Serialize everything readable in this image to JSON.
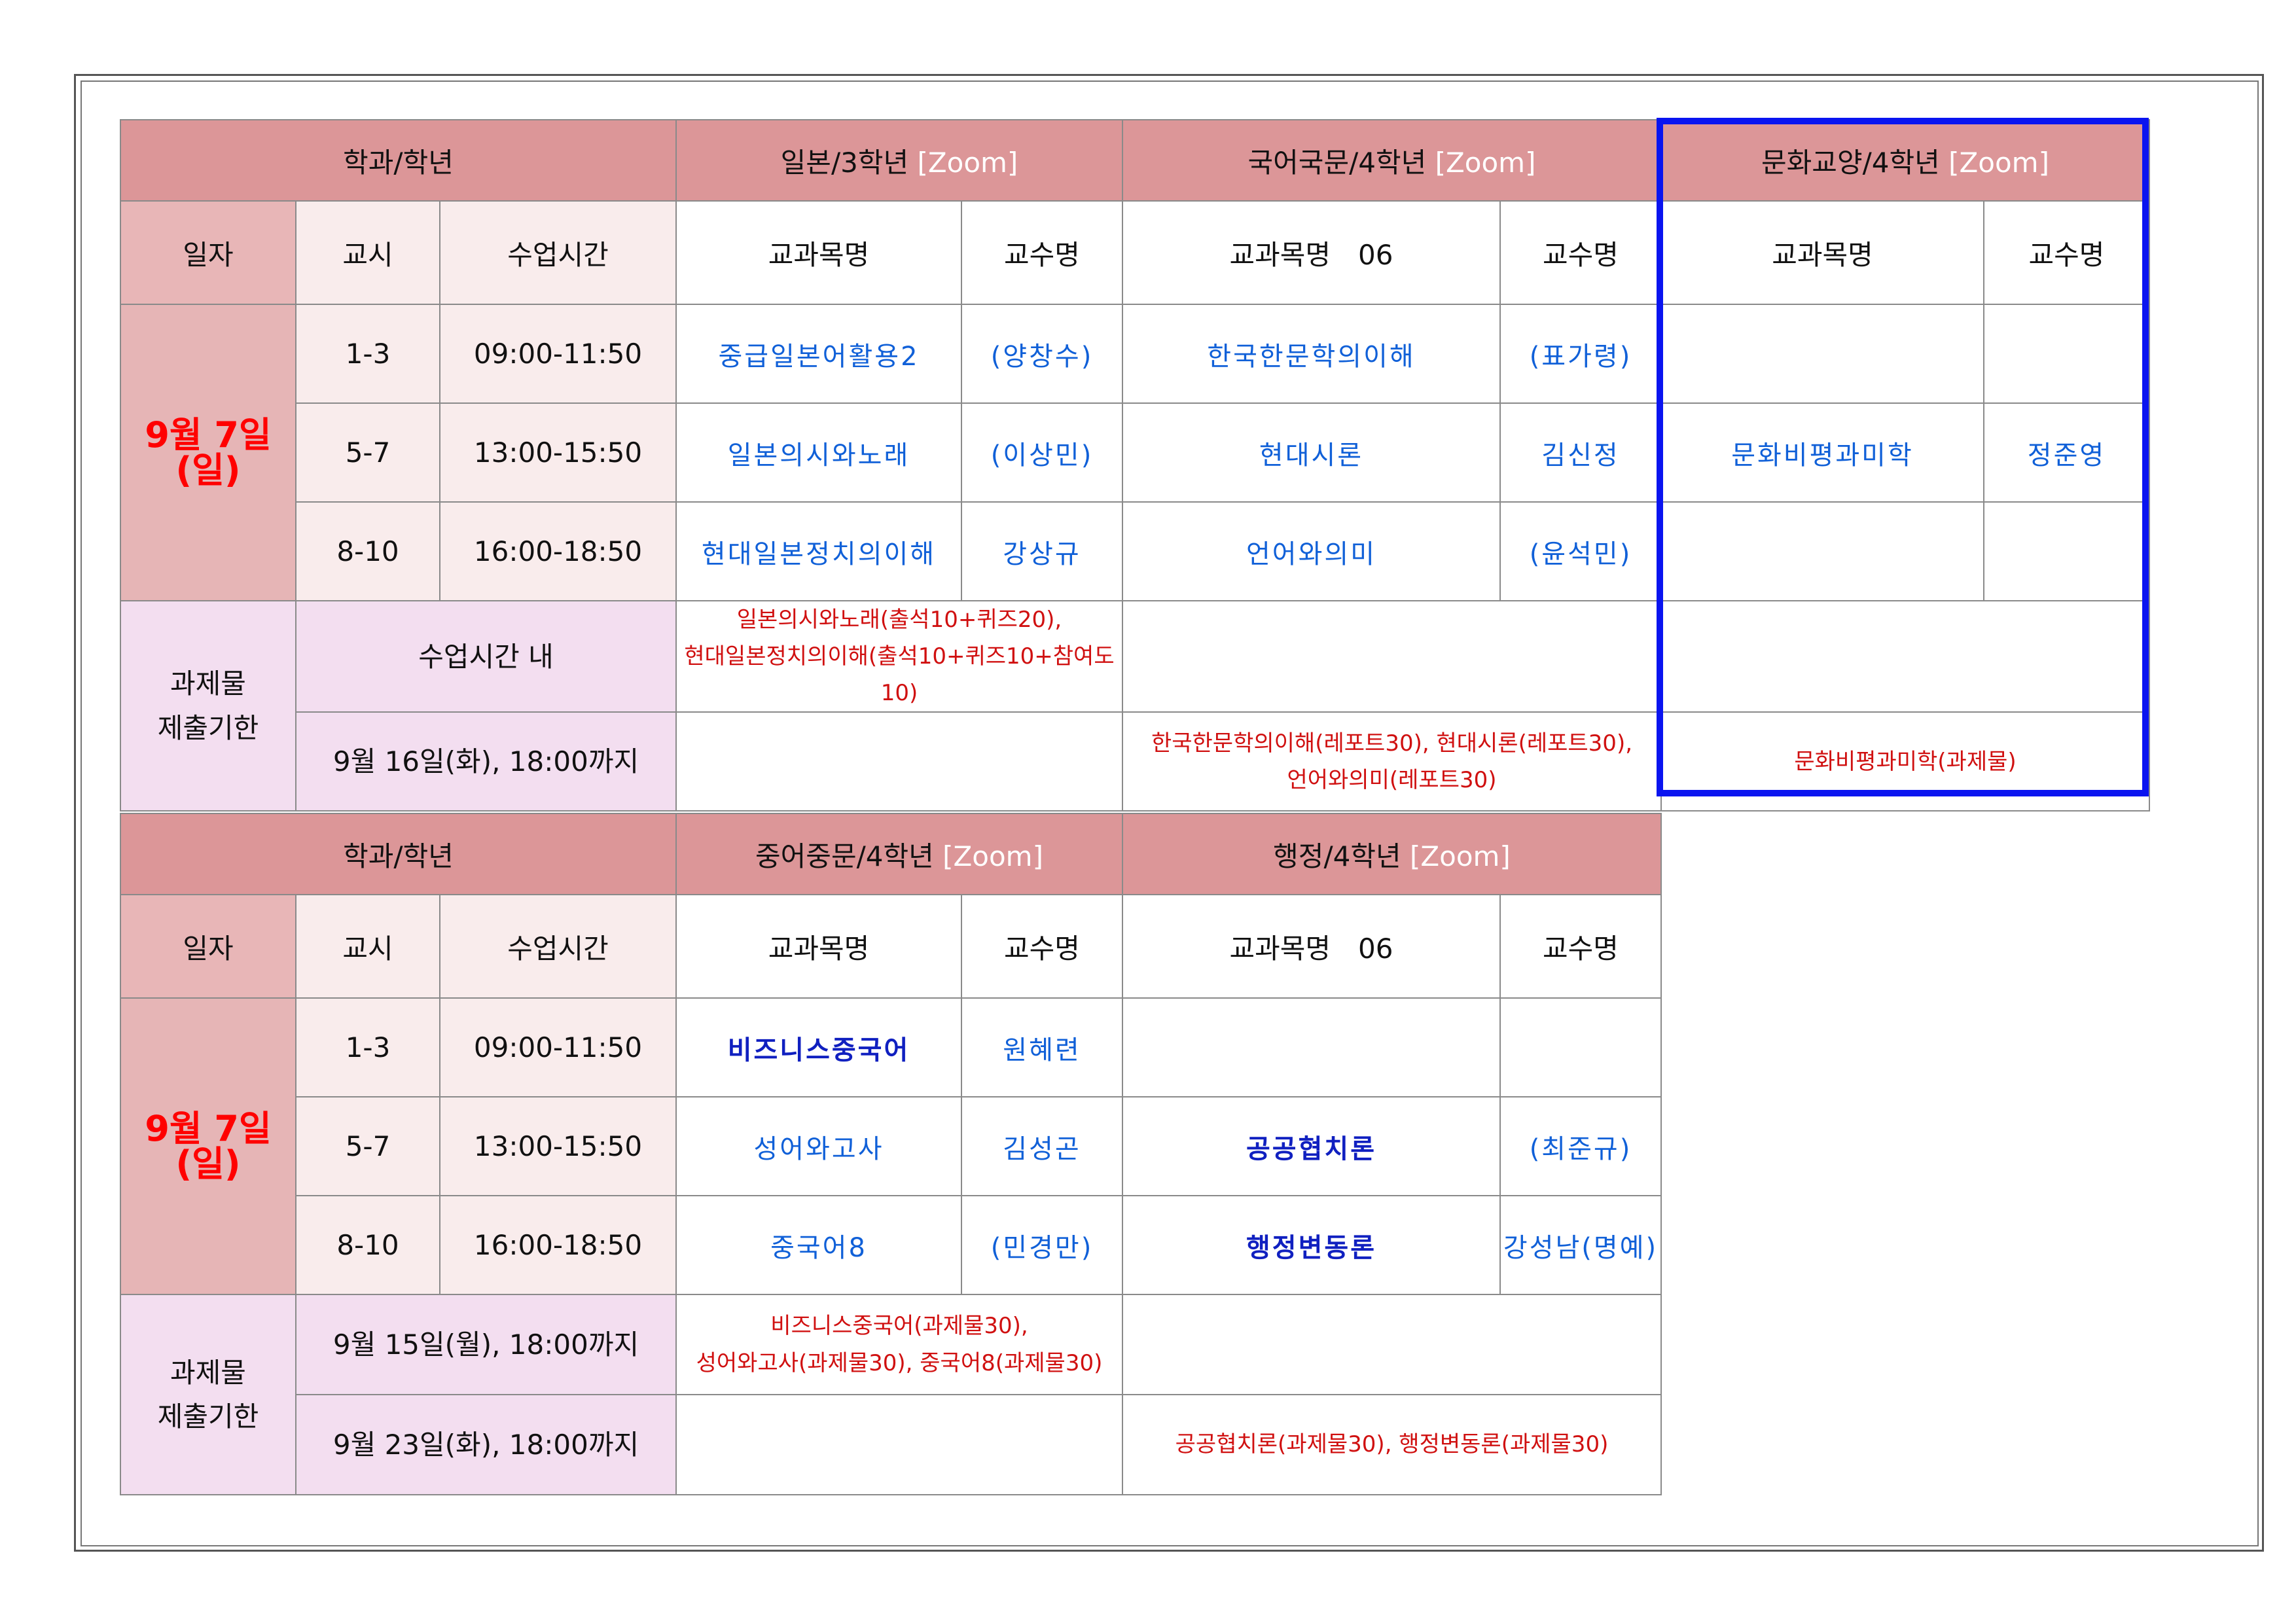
{
  "table1": {
    "header": {
      "dept": "학과/학년",
      "groups": [
        {
          "name": "일본/3학년",
          "zoom": "[Zoom]"
        },
        {
          "name": "국어국문/4학년",
          "zoom": "[Zoom]"
        },
        {
          "name": "문화교양/4학년",
          "zoom": "[Zoom]"
        }
      ]
    },
    "subheader": {
      "date": "일자",
      "period": "교시",
      "time": "수업시간",
      "g1_course": "교과목명",
      "g1_prof": "교수명",
      "g2_course": "교과목명　06",
      "g2_prof": "교수명",
      "g3_course": "교과목명",
      "g3_prof": "교수명"
    },
    "date": {
      "line1": "9월 7일",
      "line2": "(일)"
    },
    "rows": [
      {
        "period": "1-3",
        "time": "09:00-11:50",
        "g1_course": "중급일본어활용2",
        "g1_prof": "(양창수)",
        "g2_course": "한국한문학의이해",
        "g2_prof": "(표가령)",
        "g3_course": "",
        "g3_prof": ""
      },
      {
        "period": "5-7",
        "time": "13:00-15:50",
        "g1_course": "일본의시와노래",
        "g1_prof": "(이상민)",
        "g2_course": "현대시론",
        "g2_prof": "김신정",
        "g3_course": "문화비평과미학",
        "g3_prof": "정준영"
      },
      {
        "period": "8-10",
        "time": "16:00-18:50",
        "g1_course": "현대일본정치의이해",
        "g1_prof": "강상규",
        "g2_course": "언어와의미",
        "g2_prof": "(윤석민)",
        "g3_course": "",
        "g3_prof": ""
      }
    ],
    "deadline_label": {
      "line1": "과제물",
      "line2": "제출기한"
    },
    "deadlines": [
      {
        "when": "수업시간 내",
        "g1": [
          "일본의시와노래(출석10+퀴즈20),",
          "현대일본정치의이해(출석10+퀴즈10+참여도10)"
        ],
        "g2": [],
        "g3": []
      },
      {
        "when": "9월 16일(화), 18:00까지",
        "g1": [],
        "g2": [
          "한국한문학의이해(레포트30), 현대시론(레포트30),",
          "언어와의미(레포트30)"
        ],
        "g3": [
          "문화비평과미학(과제물)"
        ]
      }
    ]
  },
  "table2": {
    "header": {
      "dept": "학과/학년",
      "groups": [
        {
          "name": "중어중문/4학년",
          "zoom": "[Zoom]"
        },
        {
          "name": "행정/4학년",
          "zoom": "[Zoom]"
        }
      ]
    },
    "subheader": {
      "date": "일자",
      "period": "교시",
      "time": "수업시간",
      "g1_course": "교과목명",
      "g1_prof": "교수명",
      "g2_course": "교과목명　06",
      "g2_prof": "교수명"
    },
    "date": {
      "line1": "9월 7일",
      "line2": "(일)"
    },
    "rows": [
      {
        "period": "1-3",
        "time": "09:00-11:50",
        "g1_course": "비즈니스중국어",
        "g1_prof": "원혜련",
        "g2_course": "",
        "g2_prof": ""
      },
      {
        "period": "5-7",
        "time": "13:00-15:50",
        "g1_course": "성어와고사",
        "g1_prof": "김성곤",
        "g2_course": "공공협치론",
        "g2_prof": "(최준규)"
      },
      {
        "period": "8-10",
        "time": "16:00-18:50",
        "g1_course": "중국어8",
        "g1_prof": "(민경만)",
        "g2_course": "행정변동론",
        "g2_prof": "강성남(명예)"
      }
    ],
    "deadline_label": {
      "line1": "과제물",
      "line2": "제출기한"
    },
    "deadlines": [
      {
        "when": "9월 15일(월), 18:00까지",
        "g1": [
          "비즈니스중국어(과제물30),",
          "성어와고사(과제물30), 중국어8(과제물30)"
        ],
        "g2": []
      },
      {
        "when": "9월 23일(화), 18:00까지",
        "g1": [],
        "g2": [
          "공공협치론(과제물30), 행정변동론(과제물30)"
        ]
      }
    ]
  },
  "colors": {
    "header": "#dc9698",
    "date_bg": "#e6b5b6",
    "deadline_bg": "#f3def0",
    "light_bg": "#f9ecec",
    "course_blue": "#1060d8",
    "date_red": "#ff0000",
    "assign_red": "#d01010",
    "highlight": "#0a14f0"
  }
}
